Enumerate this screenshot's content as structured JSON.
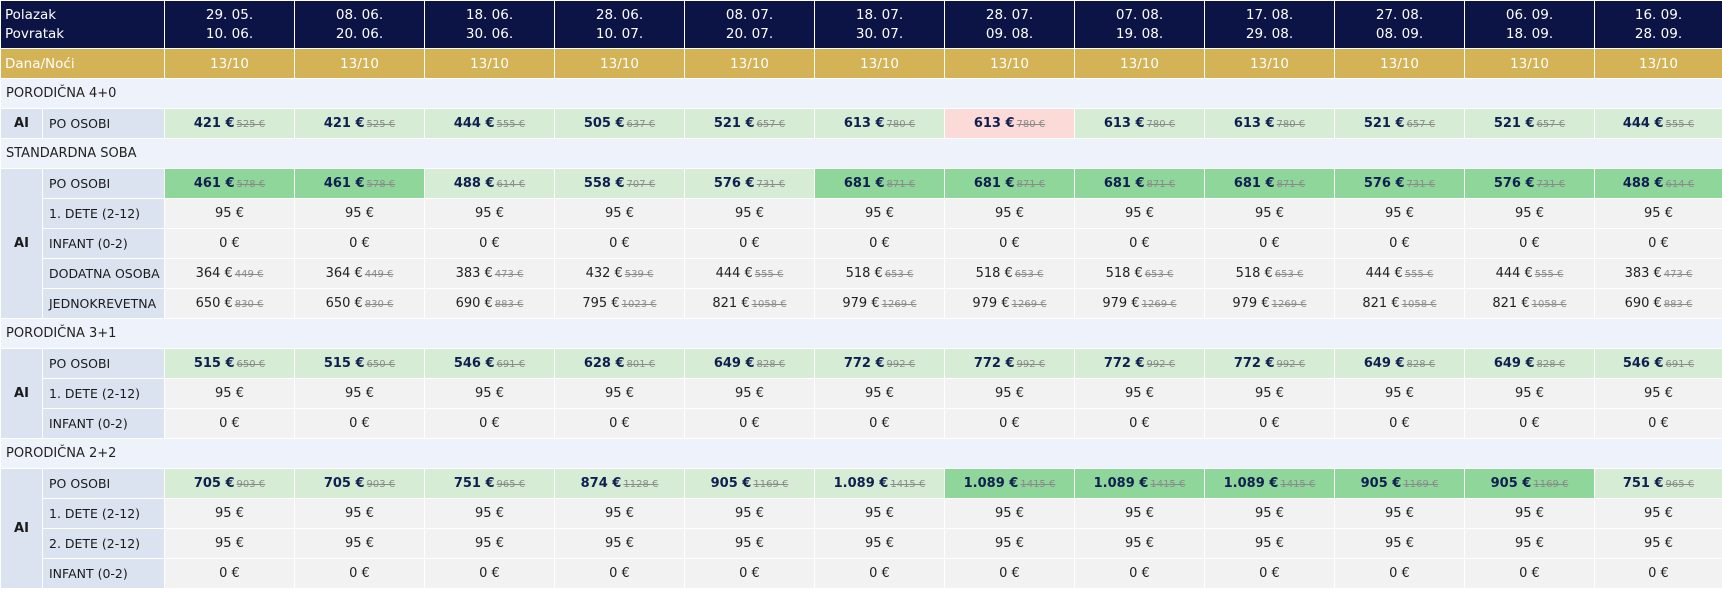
{
  "header": {
    "label_dep": "Polazak",
    "label_ret": "Povratak",
    "departures": [
      "29. 05.",
      "08. 06.",
      "18. 06.",
      "28. 06.",
      "08. 07.",
      "18. 07.",
      "28. 07.",
      "07. 08.",
      "17. 08.",
      "27. 08.",
      "06. 09.",
      "16. 09."
    ],
    "returns": [
      "10. 06.",
      "20. 06.",
      "30. 06.",
      "10. 07.",
      "20. 07.",
      "30. 07.",
      "09. 08.",
      "19. 08.",
      "29. 08.",
      "08. 09.",
      "18. 09.",
      "28. 09."
    ]
  },
  "days_row": {
    "label": "Dana/Noći",
    "values": [
      "13/10",
      "13/10",
      "13/10",
      "13/10",
      "13/10",
      "13/10",
      "13/10",
      "13/10",
      "13/10",
      "13/10",
      "13/10",
      "13/10"
    ]
  },
  "colors": {
    "header_bg": "#0b1445",
    "days_bg": "#d4b256",
    "light_green": "#d7ecd5",
    "strong_green": "#8fd69a",
    "light_red": "#fbdad7"
  },
  "sections": [
    {
      "title": "PORODIČNA 4+0",
      "board": "AI",
      "rows": [
        {
          "label": "PO OSOBI",
          "type": "price",
          "cells": [
            {
              "new": "421 €",
              "old": "525 €",
              "hl": "light"
            },
            {
              "new": "421 €",
              "old": "525 €",
              "hl": "light"
            },
            {
              "new": "444 €",
              "old": "555 €",
              "hl": "light"
            },
            {
              "new": "505 €",
              "old": "637 €",
              "hl": "light"
            },
            {
              "new": "521 €",
              "old": "657 €",
              "hl": "light"
            },
            {
              "new": "613 €",
              "old": "780 €",
              "hl": "light"
            },
            {
              "new": "613 €",
              "old": "780 €",
              "hl": "red"
            },
            {
              "new": "613 €",
              "old": "780 €",
              "hl": "light"
            },
            {
              "new": "613 €",
              "old": "780 €",
              "hl": "light"
            },
            {
              "new": "521 €",
              "old": "657 €",
              "hl": "light"
            },
            {
              "new": "521 €",
              "old": "657 €",
              "hl": "light"
            },
            {
              "new": "444 €",
              "old": "555 €",
              "hl": "light"
            }
          ]
        }
      ]
    },
    {
      "title": "STANDARDNA SOBA",
      "board": "AI",
      "rows": [
        {
          "label": "PO OSOBI",
          "type": "price",
          "cells": [
            {
              "new": "461 €",
              "old": "578 €",
              "hl": "strong"
            },
            {
              "new": "461 €",
              "old": "578 €",
              "hl": "strong"
            },
            {
              "new": "488 €",
              "old": "614 €",
              "hl": "light"
            },
            {
              "new": "558 €",
              "old": "707 €",
              "hl": "light"
            },
            {
              "new": "576 €",
              "old": "731 €",
              "hl": "light"
            },
            {
              "new": "681 €",
              "old": "871 €",
              "hl": "strong"
            },
            {
              "new": "681 €",
              "old": "871 €",
              "hl": "strong"
            },
            {
              "new": "681 €",
              "old": "871 €",
              "hl": "strong"
            },
            {
              "new": "681 €",
              "old": "871 €",
              "hl": "strong"
            },
            {
              "new": "576 €",
              "old": "731 €",
              "hl": "strong"
            },
            {
              "new": "576 €",
              "old": "731 €",
              "hl": "strong"
            },
            {
              "new": "488 €",
              "old": "614 €",
              "hl": "strong"
            }
          ]
        },
        {
          "label": "1. DETE (2-12)",
          "type": "plain",
          "cells": [
            {
              "v": "95 €"
            },
            {
              "v": "95 €"
            },
            {
              "v": "95 €"
            },
            {
              "v": "95 €"
            },
            {
              "v": "95 €"
            },
            {
              "v": "95 €"
            },
            {
              "v": "95 €"
            },
            {
              "v": "95 €"
            },
            {
              "v": "95 €"
            },
            {
              "v": "95 €"
            },
            {
              "v": "95 €"
            },
            {
              "v": "95 €"
            }
          ]
        },
        {
          "label": "INFANT (0-2)",
          "type": "plain",
          "cells": [
            {
              "v": "0 €"
            },
            {
              "v": "0 €"
            },
            {
              "v": "0 €"
            },
            {
              "v": "0 €"
            },
            {
              "v": "0 €"
            },
            {
              "v": "0 €"
            },
            {
              "v": "0 €"
            },
            {
              "v": "0 €"
            },
            {
              "v": "0 €"
            },
            {
              "v": "0 €"
            },
            {
              "v": "0 €"
            },
            {
              "v": "0 €"
            }
          ]
        },
        {
          "label": "DODATNA OSOBA",
          "type": "plainold",
          "cells": [
            {
              "v": "364 €",
              "old": "449 €"
            },
            {
              "v": "364 €",
              "old": "449 €"
            },
            {
              "v": "383 €",
              "old": "473 €"
            },
            {
              "v": "432 €",
              "old": "539 €"
            },
            {
              "v": "444 €",
              "old": "555 €"
            },
            {
              "v": "518 €",
              "old": "653 €"
            },
            {
              "v": "518 €",
              "old": "653 €"
            },
            {
              "v": "518 €",
              "old": "653 €"
            },
            {
              "v": "518 €",
              "old": "653 €"
            },
            {
              "v": "444 €",
              "old": "555 €"
            },
            {
              "v": "444 €",
              "old": "555 €"
            },
            {
              "v": "383 €",
              "old": "473 €"
            }
          ]
        },
        {
          "label": "JEDNOKREVETNA",
          "type": "plainold",
          "cells": [
            {
              "v": "650 €",
              "old": "830 €"
            },
            {
              "v": "650 €",
              "old": "830 €"
            },
            {
              "v": "690 €",
              "old": "883 €"
            },
            {
              "v": "795 €",
              "old": "1023 €"
            },
            {
              "v": "821 €",
              "old": "1058 €"
            },
            {
              "v": "979 €",
              "old": "1269 €"
            },
            {
              "v": "979 €",
              "old": "1269 €"
            },
            {
              "v": "979 €",
              "old": "1269 €"
            },
            {
              "v": "979 €",
              "old": "1269 €"
            },
            {
              "v": "821 €",
              "old": "1058 €"
            },
            {
              "v": "821 €",
              "old": "1058 €"
            },
            {
              "v": "690 €",
              "old": "883 €"
            }
          ]
        }
      ]
    },
    {
      "title": "PORODIČNA 3+1",
      "board": "AI",
      "rows": [
        {
          "label": "PO OSOBI",
          "type": "price",
          "cells": [
            {
              "new": "515 €",
              "old": "650 €",
              "hl": "light"
            },
            {
              "new": "515 €",
              "old": "650 €",
              "hl": "light"
            },
            {
              "new": "546 €",
              "old": "691 €",
              "hl": "light"
            },
            {
              "new": "628 €",
              "old": "801 €",
              "hl": "light"
            },
            {
              "new": "649 €",
              "old": "828 €",
              "hl": "light"
            },
            {
              "new": "772 €",
              "old": "992 €",
              "hl": "light"
            },
            {
              "new": "772 €",
              "old": "992 €",
              "hl": "light"
            },
            {
              "new": "772 €",
              "old": "992 €",
              "hl": "light"
            },
            {
              "new": "772 €",
              "old": "992 €",
              "hl": "light"
            },
            {
              "new": "649 €",
              "old": "828 €",
              "hl": "light"
            },
            {
              "new": "649 €",
              "old": "828 €",
              "hl": "light"
            },
            {
              "new": "546 €",
              "old": "691 €",
              "hl": "light"
            }
          ]
        },
        {
          "label": "1. DETE (2-12)",
          "type": "plain",
          "cells": [
            {
              "v": "95 €"
            },
            {
              "v": "95 €"
            },
            {
              "v": "95 €"
            },
            {
              "v": "95 €"
            },
            {
              "v": "95 €"
            },
            {
              "v": "95 €"
            },
            {
              "v": "95 €"
            },
            {
              "v": "95 €"
            },
            {
              "v": "95 €"
            },
            {
              "v": "95 €"
            },
            {
              "v": "95 €"
            },
            {
              "v": "95 €"
            }
          ]
        },
        {
          "label": "INFANT (0-2)",
          "type": "plain",
          "cells": [
            {
              "v": "0 €"
            },
            {
              "v": "0 €"
            },
            {
              "v": "0 €"
            },
            {
              "v": "0 €"
            },
            {
              "v": "0 €"
            },
            {
              "v": "0 €"
            },
            {
              "v": "0 €"
            },
            {
              "v": "0 €"
            },
            {
              "v": "0 €"
            },
            {
              "v": "0 €"
            },
            {
              "v": "0 €"
            },
            {
              "v": "0 €"
            }
          ]
        }
      ]
    },
    {
      "title": "PORODIČNA 2+2",
      "board": "AI",
      "rows": [
        {
          "label": "PO OSOBI",
          "type": "price",
          "cells": [
            {
              "new": "705 €",
              "old": "903 €",
              "hl": "light"
            },
            {
              "new": "705 €",
              "old": "903 €",
              "hl": "light"
            },
            {
              "new": "751 €",
              "old": "965 €",
              "hl": "light"
            },
            {
              "new": "874 €",
              "old": "1128 €",
              "hl": "light"
            },
            {
              "new": "905 €",
              "old": "1169 €",
              "hl": "light"
            },
            {
              "new": "1.089 €",
              "old": "1415 €",
              "hl": "light"
            },
            {
              "new": "1.089 €",
              "old": "1415 €",
              "hl": "strong"
            },
            {
              "new": "1.089 €",
              "old": "1415 €",
              "hl": "strong"
            },
            {
              "new": "1.089 €",
              "old": "1415 €",
              "hl": "strong"
            },
            {
              "new": "905 €",
              "old": "1169 €",
              "hl": "strong"
            },
            {
              "new": "905 €",
              "old": "1169 €",
              "hl": "strong"
            },
            {
              "new": "751 €",
              "old": "965 €",
              "hl": "light"
            }
          ]
        },
        {
          "label": "1. DETE (2-12)",
          "type": "plain",
          "cells": [
            {
              "v": "95 €"
            },
            {
              "v": "95 €"
            },
            {
              "v": "95 €"
            },
            {
              "v": "95 €"
            },
            {
              "v": "95 €"
            },
            {
              "v": "95 €"
            },
            {
              "v": "95 €"
            },
            {
              "v": "95 €"
            },
            {
              "v": "95 €"
            },
            {
              "v": "95 €"
            },
            {
              "v": "95 €"
            },
            {
              "v": "95 €"
            }
          ]
        },
        {
          "label": "2. DETE (2-12)",
          "type": "plain",
          "cells": [
            {
              "v": "95 €"
            },
            {
              "v": "95 €"
            },
            {
              "v": "95 €"
            },
            {
              "v": "95 €"
            },
            {
              "v": "95 €"
            },
            {
              "v": "95 €"
            },
            {
              "v": "95 €"
            },
            {
              "v": "95 €"
            },
            {
              "v": "95 €"
            },
            {
              "v": "95 €"
            },
            {
              "v": "95 €"
            },
            {
              "v": "95 €"
            }
          ]
        },
        {
          "label": "INFANT (0-2)",
          "type": "plain",
          "cells": [
            {
              "v": "0 €"
            },
            {
              "v": "0 €"
            },
            {
              "v": "0 €"
            },
            {
              "v": "0 €"
            },
            {
              "v": "0 €"
            },
            {
              "v": "0 €"
            },
            {
              "v": "0 €"
            },
            {
              "v": "0 €"
            },
            {
              "v": "0 €"
            },
            {
              "v": "0 €"
            },
            {
              "v": "0 €"
            },
            {
              "v": "0 €"
            }
          ]
        }
      ]
    }
  ]
}
